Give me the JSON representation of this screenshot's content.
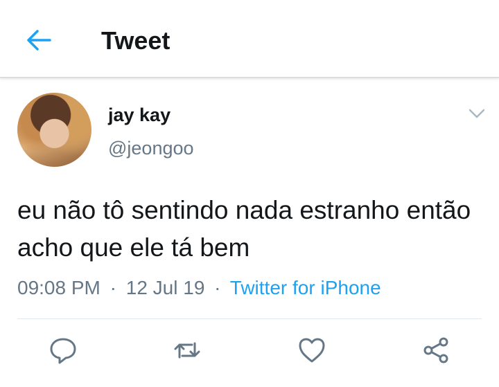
{
  "header": {
    "title": "Tweet",
    "back_icon": "arrow-left-icon"
  },
  "colors": {
    "accent": "#1da1f2",
    "secondary_text": "#657786",
    "primary_text": "#14171a"
  },
  "tweet": {
    "display_name": "jay kay",
    "handle": "@jeongoo",
    "text": "eu não tô sentindo nada estranho então acho que ele tá bem",
    "time": "09:08 PM",
    "date": "12 Jul 19",
    "separator": "·",
    "source": "Twitter for iPhone"
  },
  "actions": {
    "reply_icon": "reply-icon",
    "retweet_icon": "retweet-icon",
    "like_icon": "heart-icon",
    "share_icon": "share-icon"
  }
}
